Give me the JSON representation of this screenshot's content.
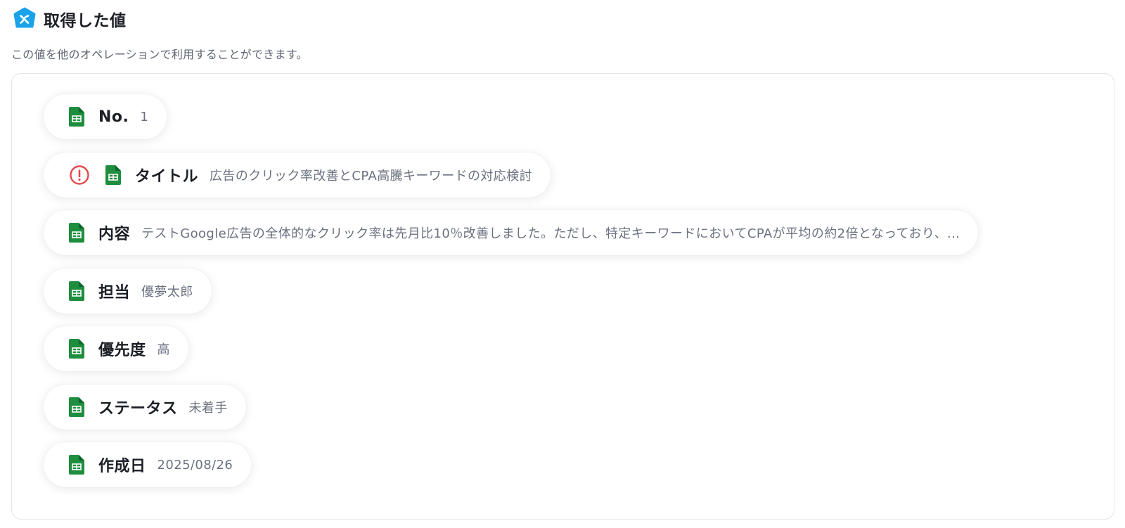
{
  "header": {
    "icon": "yoom-logo-icon",
    "title": "取得した値",
    "accent_color": "#1aa3ea"
  },
  "description": "この値を他のオペレーションで利用することができます。",
  "fields": [
    {
      "label": "No.",
      "value": "1",
      "icon": "google-sheets-icon",
      "warning": false
    },
    {
      "label": "タイトル",
      "value": "広告のクリック率改善とCPA高騰キーワードの対応検討",
      "icon": "google-sheets-icon",
      "warning": true
    },
    {
      "label": "内容",
      "value": "テストGoogle広告の全体的なクリック率は先月比10％改善しました。ただし、特定キーワードにおいてCPAが平均の約2倍となっており、...",
      "icon": "google-sheets-icon",
      "warning": false
    },
    {
      "label": "担当",
      "value": "優夢太郎",
      "icon": "google-sheets-icon",
      "warning": false
    },
    {
      "label": "優先度",
      "value": "高",
      "icon": "google-sheets-icon",
      "warning": false
    },
    {
      "label": "ステータス",
      "value": "未着手",
      "icon": "google-sheets-icon",
      "warning": false
    },
    {
      "label": "作成日",
      "value": "2025/08/26",
      "icon": "google-sheets-icon",
      "warning": false
    }
  ],
  "colors": {
    "sheets_green": "#1e8e3e",
    "warning_red": "#e5484d",
    "panel_border": "#e2e4ea"
  }
}
